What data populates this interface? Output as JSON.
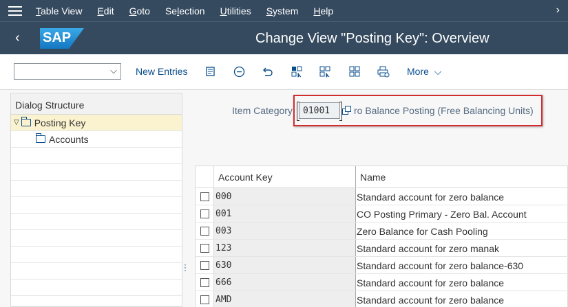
{
  "menubar": {
    "items": [
      "Table View",
      "Edit",
      "Goto",
      "Selection",
      "Utilities",
      "System",
      "Help"
    ],
    "underline": [
      "T",
      "E",
      "G",
      "l",
      "U",
      "S",
      "H"
    ],
    "overflow_glyph": "›"
  },
  "header": {
    "back_glyph": "‹",
    "logo_text": "SAP",
    "title": "Change View \"Posting Key\": Overview"
  },
  "toolbar": {
    "dropdown_value": "",
    "new_entries_label": "New Entries",
    "more_label": "More",
    "icons": [
      "details-icon",
      "delete-icon",
      "undo-icon",
      "select-all-icon",
      "select-block-icon",
      "deselect-all-icon",
      "print-icon"
    ]
  },
  "dialog_structure": {
    "heading": "Dialog Structure",
    "items": [
      {
        "label": "Posting Key",
        "level": 0,
        "expanded": true,
        "selected": true
      },
      {
        "label": "Accounts",
        "level": 1,
        "expanded": false,
        "selected": false
      }
    ]
  },
  "item_category": {
    "label": "Item Category:",
    "value": "01001",
    "description": "Zero Balance Posting (Free Balancing Units)",
    "description_visible": "ro Balance Posting (Free Balancing Units)"
  },
  "table": {
    "columns": [
      "Account Key",
      "Name"
    ],
    "rows": [
      {
        "key": "000",
        "name": "Standard account for zero balance"
      },
      {
        "key": "001",
        "name": "CO Posting Primary - Zero Bal. Account"
      },
      {
        "key": "003",
        "name": "Zero Balance for Cash Pooling"
      },
      {
        "key": "123",
        "name": "Standard account for zero manak"
      },
      {
        "key": "630",
        "name": "Standard account for zero balance-630"
      },
      {
        "key": "666",
        "name": "Standard account for zero balance"
      },
      {
        "key": "AMD",
        "name": "Standard account for zero balance"
      }
    ]
  },
  "colors": {
    "shell": "#354a5f",
    "link": "#0a4d8c",
    "highlight": "#d22c2c",
    "selected_row": "#fbf3d0"
  }
}
